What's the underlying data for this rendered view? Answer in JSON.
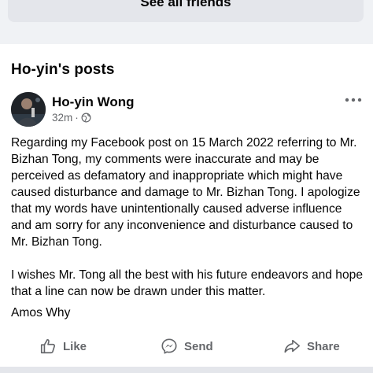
{
  "friends_card": {
    "see_all_label": "See all friends"
  },
  "section": {
    "title": "Ho-yin's posts"
  },
  "post": {
    "author": "Ho-yin Wong",
    "time": "32m",
    "privacy_icon": "globe-icon",
    "paragraphs": [
      "Regarding my Facebook post on 15 March 2022 referring to Mr. Bizhan Tong, my comments were inaccurate and may be perceived as defamatory and inappropriate which might have caused disturbance and damage to Mr. Bizhan Tong. I apologize that my words have unintentionally caused adverse influence and am sorry for any inconvenience and disturbance caused to Mr. Bizhan Tong.",
      "I wishes Mr. Tong all the best with his future endeavors and hope that a line can now be drawn under this matter."
    ],
    "signature": "Amos Why"
  },
  "actions": {
    "like_label": "Like",
    "send_label": "Send",
    "share_label": "Share"
  },
  "colors": {
    "text": "#050505",
    "secondary": "#65676b",
    "card_bg": "#e4e6eb"
  }
}
